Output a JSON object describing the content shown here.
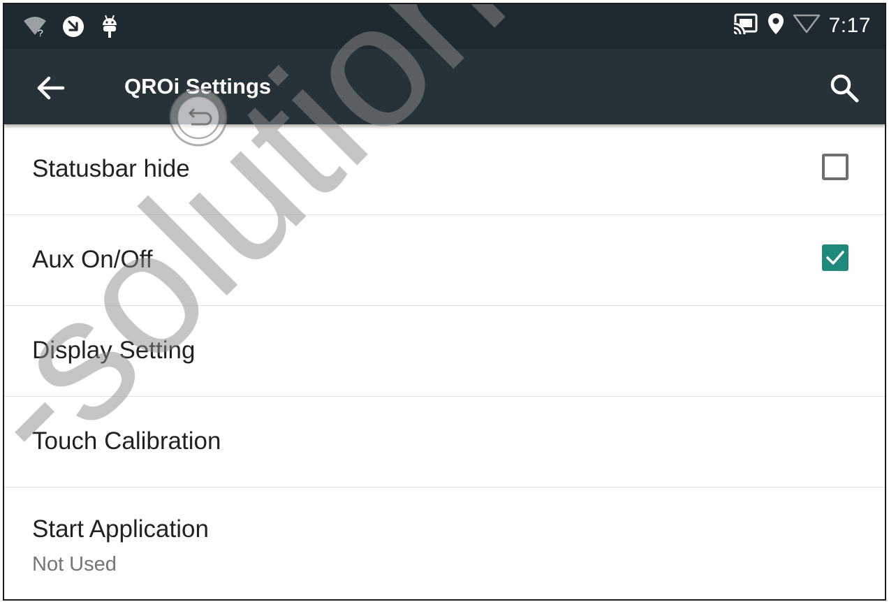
{
  "status_bar": {
    "time": "7:17",
    "left_icons": [
      "wifi-unknown-icon",
      "notification-arrow-icon",
      "android-debug-icon"
    ],
    "right_icons": [
      "cast-icon",
      "location-icon",
      "signal-icon"
    ]
  },
  "app_bar": {
    "title": "QROi Settings",
    "back_icon": "arrow-back-icon",
    "search_icon": "search-icon"
  },
  "settings": [
    {
      "title": "Statusbar hide",
      "subtitle": "",
      "checkbox": "unchecked"
    },
    {
      "title": "Aux On/Off",
      "subtitle": "",
      "checkbox": "checked"
    },
    {
      "title": "Display Setting",
      "subtitle": "",
      "checkbox": "none"
    },
    {
      "title": "Touch Calibration",
      "subtitle": "",
      "checkbox": "none"
    },
    {
      "title": "Start Application",
      "subtitle": "Not Used",
      "checkbox": "none"
    }
  ],
  "watermark": {
    "text": "-solutions.com"
  },
  "colors": {
    "status_bar": "#1e2a30",
    "app_bar": "#263238",
    "accent": "#1f8a7c",
    "primary_text": "#212121",
    "secondary_text": "#757575"
  }
}
